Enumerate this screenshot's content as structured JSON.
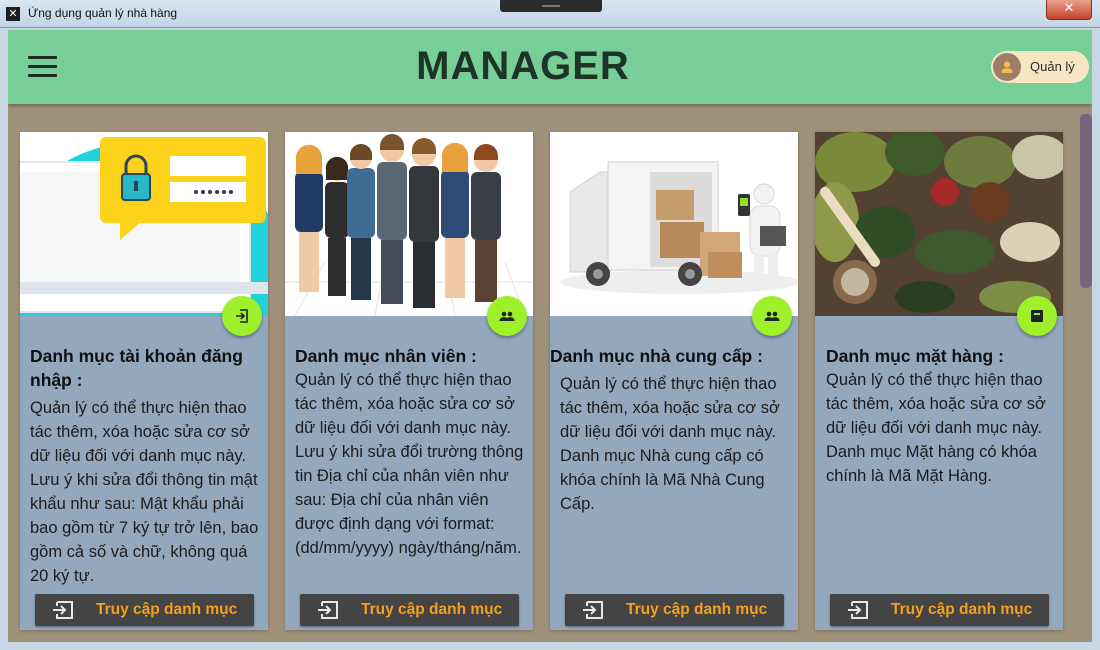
{
  "window": {
    "title": "Ứng dụng quản lý nhà hàng",
    "close_label": "✕"
  },
  "header": {
    "title": "MANAGER",
    "user_name": "Quản lý"
  },
  "cards": [
    {
      "title": "Danh mục tài khoản đăng nhập :",
      "description": "Quản lý có thể thực hiện thao tác thêm, xóa hoặc sửa cơ sở dữ liệu đối với danh mục này. Lưu ý khi sửa đổi thông tin mật khẩu như sau: Mật khẩu phải bao gồm từ 7 ký tự trở lên, bao gồm cả số và chữ, không quá 20 ký tự.",
      "button_label": "Truy cập danh mục",
      "fab_icon": "login-icon",
      "image": "login-illustration"
    },
    {
      "title": "Danh mục nhân viên :",
      "description": "Quản lý có thể thực hiện thao tác thêm, xóa hoặc sửa cơ sở dữ liệu đối với danh mục này. Lưu ý khi sửa đổi trường thông tin Địa chỉ của nhân viên như sau: Địa chỉ của nhân viên được định dạng với format: (dd/mm/yyyy) ngày/tháng/năm.",
      "button_label": "Truy cập danh mục",
      "fab_icon": "people-icon",
      "image": "staff-illustration"
    },
    {
      "title": "Danh mục nhà cung cấp :",
      "description": "Quản lý có thể thực hiện thao tác thêm, xóa hoặc sửa cơ sở dữ liệu đối với danh mục này. Danh mục Nhà cung cấp có khóa chính là Mã Nhà Cung Cấp.",
      "button_label": "Truy cập danh mục",
      "fab_icon": "people-icon",
      "image": "delivery-truck-photo"
    },
    {
      "title": "Danh mục mặt hàng :",
      "description": "Quản lý có thể thực hiện thao tác thêm, xóa hoặc sửa cơ sở dữ liệu đối với danh mục này. Danh mục Mặt hàng có khóa chính là Mã Mặt Hàng.",
      "button_label": "Truy cập danh mục",
      "fab_icon": "box-icon",
      "image": "vegetables-photo"
    }
  ],
  "colors": {
    "header_bg": "#77cf97",
    "client_bg": "#9f9079",
    "card_bg": "#93a8bd",
    "fab_bg": "#9ef02b",
    "button_bg": "#444444",
    "button_text": "#f4a01c",
    "user_chip_bg": "#f6e6c4"
  }
}
